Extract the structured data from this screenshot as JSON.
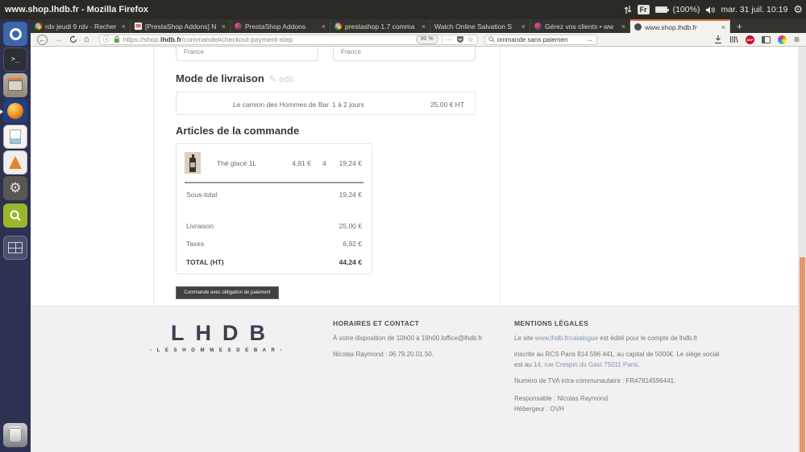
{
  "desktop": {
    "title": "www.shop.lhdb.fr - Mozilla Firefox",
    "indicators": {
      "keyboard": "Fr",
      "battery": "(100%)",
      "clock": "mar. 31 juil. 10:19"
    },
    "launcher_items": [
      "ubuntu-dash",
      "terminal",
      "file-manager",
      "firefox",
      "libreoffice-document",
      "vlc",
      "system-settings",
      "screenshot-tool",
      "workspace-switcher",
      "trash"
    ],
    "terminal_glyph": ">_"
  },
  "browser": {
    "tabs": [
      {
        "label": "rdv jeudi 9 rdv - Recher",
        "favicon": "google"
      },
      {
        "label": "[PrestaShop Addons] N",
        "favicon": "gmail"
      },
      {
        "label": "PrestaShop Addons",
        "favicon": "prestashop"
      },
      {
        "label": "prestashop 1.7 comma",
        "favicon": "google"
      },
      {
        "label": "Watch Online Salvation S",
        "favicon": "none"
      },
      {
        "label": "Gérez vos clients • ww",
        "favicon": "prestashop"
      },
      {
        "label": "www.shop.lhdb.fr",
        "favicon": "globe"
      }
    ],
    "close_glyph": "×",
    "new_tab_glyph": "+",
    "favicon_g": "G",
    "favicon_mail": "✉",
    "nav": {
      "back_glyph": "←",
      "forward_glyph": "→",
      "home_glyph": "⌂",
      "url_scheme": "https://shop.",
      "url_domain": "lhdb.fr",
      "url_path": "/commande#checkout-payment-step",
      "zoom_level": "90 %",
      "more_glyph": "⋯",
      "star_glyph": "☆",
      "search_value": "ommande sans paiemen",
      "go_glyph": "→",
      "abp_label": "ABP",
      "menu_glyph": "≡"
    }
  },
  "page": {
    "address_fields": {
      "invoice_country": "France",
      "delivery_country": "France"
    },
    "shipping": {
      "title": "Mode de livraison",
      "edit_glyph": "✎",
      "edit_label": "edit",
      "carrier": "Le camion des Hommes de Bar",
      "delay": "1 à 2 jours",
      "price": "25,00 € HT"
    },
    "order": {
      "title": "Articles de la commande",
      "product": {
        "name": "Thé glacé 1L",
        "unit_price": "4,81 €",
        "quantity": "4",
        "total": "19,24 €"
      },
      "summary": [
        {
          "label": "Sous-total",
          "value": "19,24 €"
        },
        {
          "label": "Livraison",
          "value": "25,00 €"
        },
        {
          "label": "Taxes",
          "value": "6,92 €"
        }
      ],
      "total": {
        "label": "TOTAL (HT)",
        "value": "44,24 €"
      }
    },
    "order_button": "Commande avec obligation de paiement",
    "footer": {
      "logo_letters": "LHDB",
      "logo_subtitle": "-  L E S   H O M M E S   D E   B A R  -",
      "contact": {
        "title": "HORAIRES ET CONTACT",
        "line1": "À votre disposition de 10h00 à 19h00.loffice@lhdb.fr",
        "line2": "Nicolas Raymond : 06.79.20.01.50."
      },
      "legal": {
        "title": "MENTIONS LÉGALES",
        "p1_pre": "Le site ",
        "p1_link": "www.lhdb.fr/catalogue",
        "p1_post": " est édité pour le compte de lhdb.fr",
        "p2_pre": "inscrite au RCS Paris 814 596 441, au capital de 5000€. Le siège social est au ",
        "p2_link": "14, rue Crespin du Gast 75011 Paris",
        "p2_post": ".",
        "p3": "Numéro de TVA intra-communautaire : FR47814596441.",
        "p4": "Responsable : Nicolas Raymond",
        "p5": "Hébergeur : OVH"
      }
    }
  },
  "colors": {
    "active_tab_accent": "#e2703f",
    "scrollbar_thumb": "#e8946f",
    "lock_green": "#57a957",
    "abp_red": "#c70d2c"
  }
}
